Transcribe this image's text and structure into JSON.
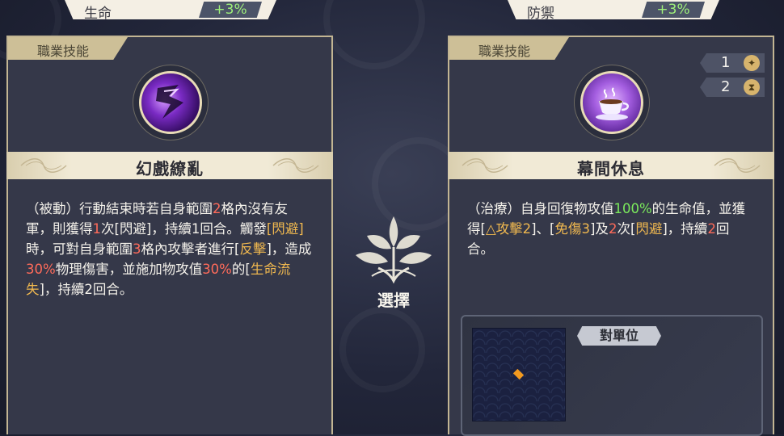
{
  "left_stat": {
    "label": "生命",
    "value": "+3%"
  },
  "right_stat": {
    "label": "防禦",
    "value": "+3%"
  },
  "left_card": {
    "tag": "職業技能",
    "skill_name": "幻戲繚亂",
    "icon": "shadow-slash-skill-icon",
    "desc": [
      {
        "t": "（被動）行動結束時若自身範圍"
      },
      {
        "t": "2",
        "c": "red"
      },
      {
        "t": "格內沒有友軍，則獲得"
      },
      {
        "t": "1",
        "c": "red"
      },
      {
        "t": "次[閃避]，持續1回合。觸發"
      },
      {
        "t": "[閃避]",
        "c": "gold"
      },
      {
        "t": "時，可對自身範圍"
      },
      {
        "t": "3",
        "c": "red"
      },
      {
        "t": "格內攻擊者進行["
      },
      {
        "t": "反擊",
        "c": "gold"
      },
      {
        "t": "]，造成"
      },
      {
        "t": "30%",
        "c": "red"
      },
      {
        "t": "物理傷害，並施加物攻值"
      },
      {
        "t": "30%",
        "c": "red"
      },
      {
        "t": "的["
      },
      {
        "t": "生命流失",
        "c": "gold"
      },
      {
        "t": "]，持續2回合。"
      }
    ]
  },
  "center": {
    "select_label": "選擇"
  },
  "right_card": {
    "tag": "職業技能",
    "skill_name": "幕間休息",
    "icon": "teacup-skill-icon",
    "counter_1": {
      "value": "1",
      "icon": "star-icon"
    },
    "counter_2": {
      "value": "2",
      "icon": "hourglass-icon"
    },
    "desc": [
      {
        "t": "（治療）自身回復物攻值"
      },
      {
        "t": "100%",
        "c": "green"
      },
      {
        "t": "的生命值，並獲得["
      },
      {
        "t": "△攻擊2",
        "c": "gold"
      },
      {
        "t": "]、["
      },
      {
        "t": "免傷3",
        "c": "gold"
      },
      {
        "t": "]及"
      },
      {
        "t": "2",
        "c": "red"
      },
      {
        "t": "次["
      },
      {
        "t": "閃避",
        "c": "gold"
      },
      {
        "t": "]，持續"
      },
      {
        "t": "2",
        "c": "red"
      },
      {
        "t": "回合。"
      }
    ],
    "range": {
      "target_label": "對單位"
    }
  },
  "colors": {
    "red": "#ff6b5a",
    "gold": "#f0b84f",
    "green": "#7bea5c",
    "frame": "#c2b593"
  }
}
